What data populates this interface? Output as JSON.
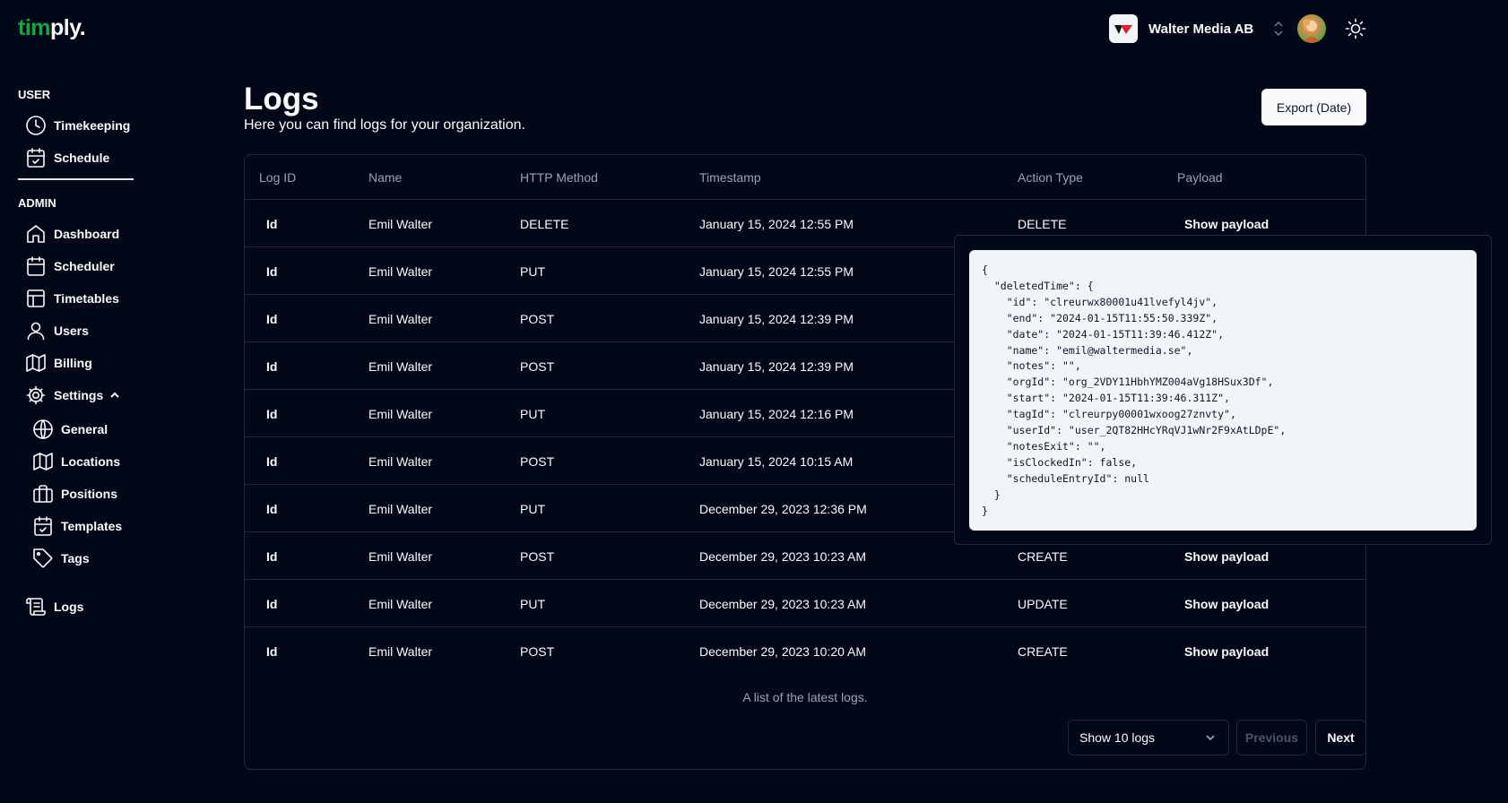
{
  "brand": {
    "part1": "tim",
    "part2": "ply."
  },
  "header": {
    "org_name": "Walter Media AB"
  },
  "sidebar": {
    "user_label": "USER",
    "admin_label": "ADMIN",
    "user_items": [
      {
        "label": "Timekeeping",
        "icon": "clock-icon"
      },
      {
        "label": "Schedule",
        "icon": "calendar-check-icon"
      }
    ],
    "admin_items": [
      {
        "label": "Dashboard",
        "icon": "home-icon"
      },
      {
        "label": "Scheduler",
        "icon": "calendar-icon"
      },
      {
        "label": "Timetables",
        "icon": "table-icon"
      },
      {
        "label": "Users",
        "icon": "user-icon"
      },
      {
        "label": "Billing",
        "icon": "map-icon"
      },
      {
        "label": "Settings",
        "icon": "gear-icon"
      }
    ],
    "settings_items": [
      {
        "label": "General",
        "icon": "globe-icon"
      },
      {
        "label": "Locations",
        "icon": "map-icon"
      },
      {
        "label": "Positions",
        "icon": "briefcase-icon"
      },
      {
        "label": "Templates",
        "icon": "calendar-check-icon"
      },
      {
        "label": "Tags",
        "icon": "tag-icon"
      }
    ],
    "logs_item": {
      "label": "Logs",
      "icon": "scroll-icon"
    }
  },
  "page": {
    "title": "Logs",
    "subtitle": "Here you can find logs for your organization.",
    "export_label": "Export (Date)"
  },
  "table": {
    "columns": [
      "Log ID",
      "Name",
      "HTTP Method",
      "Timestamp",
      "Action Type",
      "Payload"
    ],
    "rows": [
      {
        "id": "Id",
        "name": "Emil Walter",
        "method": "DELETE",
        "timestamp": "January 15, 2024 12:55 PM",
        "action": "DELETE",
        "payload": "Show payload"
      },
      {
        "id": "Id",
        "name": "Emil Walter",
        "method": "PUT",
        "timestamp": "January 15, 2024 12:55 PM",
        "action": "",
        "payload": ""
      },
      {
        "id": "Id",
        "name": "Emil Walter",
        "method": "POST",
        "timestamp": "January 15, 2024 12:39 PM",
        "action": "",
        "payload": ""
      },
      {
        "id": "Id",
        "name": "Emil Walter",
        "method": "POST",
        "timestamp": "January 15, 2024 12:39 PM",
        "action": "",
        "payload": ""
      },
      {
        "id": "Id",
        "name": "Emil Walter",
        "method": "PUT",
        "timestamp": "January 15, 2024 12:16 PM",
        "action": "",
        "payload": ""
      },
      {
        "id": "Id",
        "name": "Emil Walter",
        "method": "POST",
        "timestamp": "January 15, 2024 10:15 AM",
        "action": "",
        "payload": ""
      },
      {
        "id": "Id",
        "name": "Emil Walter",
        "method": "PUT",
        "timestamp": "December 29, 2023 12:36 PM",
        "action": "",
        "payload": ""
      },
      {
        "id": "Id",
        "name": "Emil Walter",
        "method": "POST",
        "timestamp": "December 29, 2023 10:23 AM",
        "action": "CREATE",
        "payload": "Show payload"
      },
      {
        "id": "Id",
        "name": "Emil Walter",
        "method": "PUT",
        "timestamp": "December 29, 2023 10:23 AM",
        "action": "UPDATE",
        "payload": "Show payload"
      },
      {
        "id": "Id",
        "name": "Emil Walter",
        "method": "POST",
        "timestamp": "December 29, 2023 10:20 AM",
        "action": "CREATE",
        "payload": "Show payload"
      }
    ],
    "caption": "A list of the latest logs."
  },
  "pagination": {
    "page_size_label": "Show 10 logs",
    "previous_label": "Previous",
    "next_label": "Next"
  },
  "payload_popover": {
    "json_text": "{\n  \"deletedTime\": {\n    \"id\": \"clreurwx80001u41lvefyl4jv\",\n    \"end\": \"2024-01-15T11:55:50.339Z\",\n    \"date\": \"2024-01-15T11:39:46.412Z\",\n    \"name\": \"emil@waltermedia.se\",\n    \"notes\": \"\",\n    \"orgId\": \"org_2VDY11HbhYMZ004aVg18HSux3Df\",\n    \"start\": \"2024-01-15T11:39:46.311Z\",\n    \"tagId\": \"clreurpy00001wxoog27znvty\",\n    \"userId\": \"user_2QT82HHcYRqVJ1wNr2F9xAtLDpE\",\n    \"notesExit\": \"\",\n    \"isClockedIn\": false,\n    \"scheduleEntryId\": null\n  }\n}"
  },
  "colors": {
    "background": "#020817",
    "brand_green": "#16a34a",
    "border": "#1e293b",
    "muted_text": "#94a3b8"
  }
}
